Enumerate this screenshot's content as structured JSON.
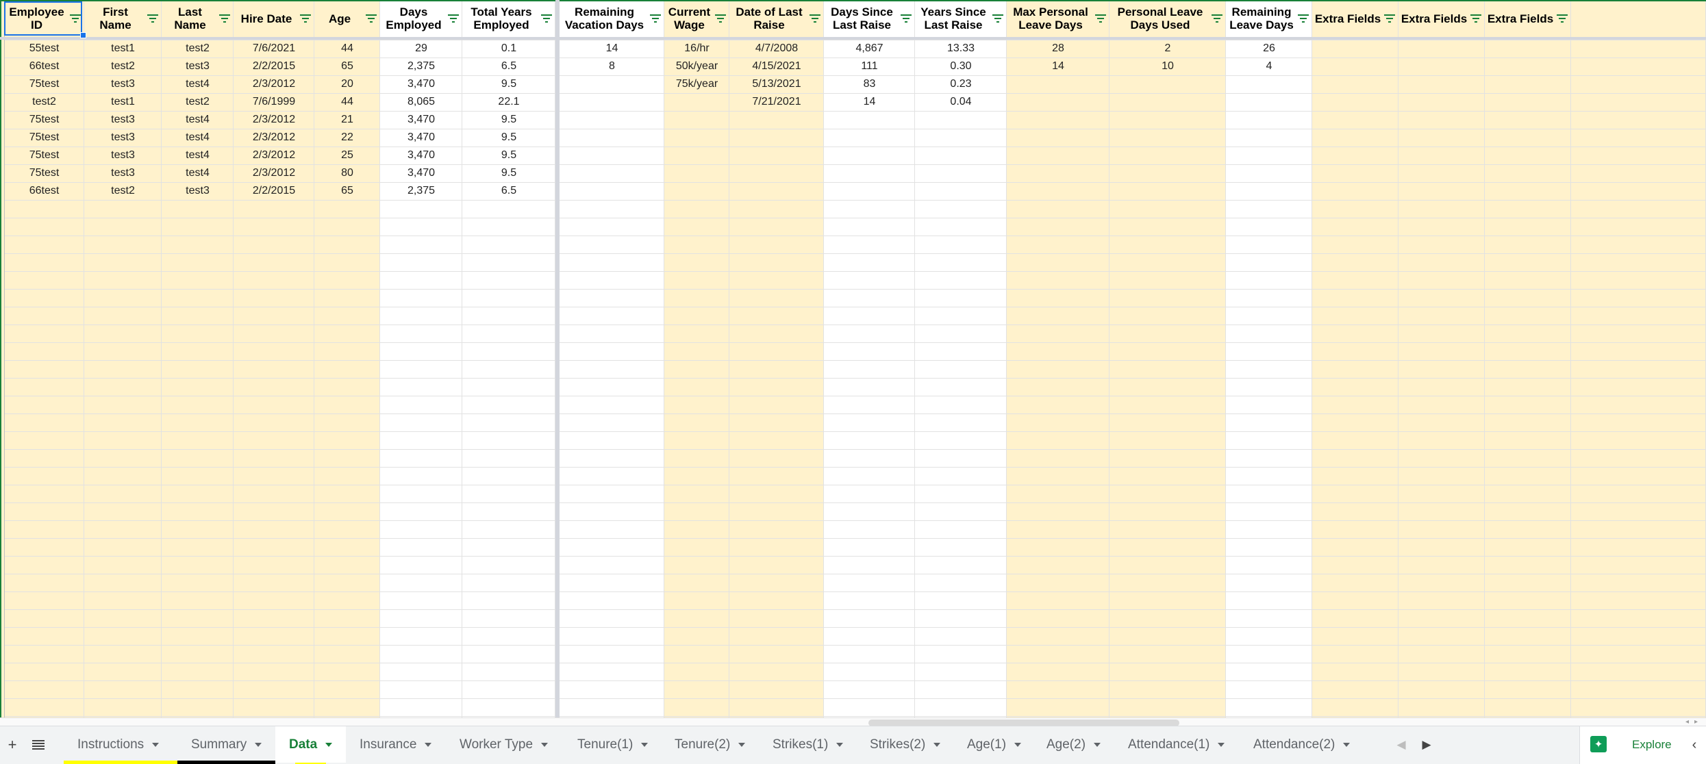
{
  "columns": [
    {
      "label": "Employee ID",
      "lines": [
        "Employee",
        "ID"
      ],
      "shade": "yellow"
    },
    {
      "label": "First Name",
      "lines": [
        "First",
        "Name"
      ],
      "shade": "yellow"
    },
    {
      "label": "Last Name",
      "lines": [
        "Last",
        "Name"
      ],
      "shade": "yellow"
    },
    {
      "label": "Hire Date",
      "lines": [
        "Hire Date"
      ],
      "shade": "yellow"
    },
    {
      "label": "Age",
      "lines": [
        "Age"
      ],
      "shade": "yellow"
    },
    {
      "label": "Days Employed",
      "lines": [
        "Days",
        "Employed"
      ],
      "shade": "white"
    },
    {
      "label": "Total Years Employed",
      "lines": [
        "Total Years",
        "Employed"
      ],
      "shade": "white"
    },
    {
      "label": "Remaining Vacation Days",
      "lines": [
        "Remaining",
        "Vacation Days"
      ],
      "shade": "white"
    },
    {
      "label": "Current Wage",
      "lines": [
        "Current",
        "Wage"
      ],
      "shade": "yellow"
    },
    {
      "label": "Date of Last Raise",
      "lines": [
        "Date of Last",
        "Raise"
      ],
      "shade": "yellow"
    },
    {
      "label": "Days Since Last Raise",
      "lines": [
        "Days Since",
        "Last Raise"
      ],
      "shade": "white"
    },
    {
      "label": "Years Since Last Raise",
      "lines": [
        "Years Since",
        "Last Raise"
      ],
      "shade": "white"
    },
    {
      "label": "Max Personal Leave Days",
      "lines": [
        "Max Personal",
        "Leave Days"
      ],
      "shade": "yellow"
    },
    {
      "label": "Personal Leave Days Used",
      "lines": [
        "Personal Leave",
        "Days Used"
      ],
      "shade": "yellow"
    },
    {
      "label": "Remaining Leave Days",
      "lines": [
        "Remaining",
        "Leave Days"
      ],
      "shade": "white"
    },
    {
      "label": "Extra Fields",
      "lines": [
        "Extra",
        "Fields"
      ],
      "shade": "yellow"
    },
    {
      "label": "Extra Fields",
      "lines": [
        "Extra",
        "Fields"
      ],
      "shade": "yellow"
    },
    {
      "label": "Extra Fields",
      "lines": [
        "Extra",
        "Fields"
      ],
      "shade": "yellow"
    },
    {
      "label": "",
      "lines": [],
      "shade": "yellow"
    }
  ],
  "rows": [
    [
      "55test",
      "test1",
      "test2",
      "7/6/2021",
      "44",
      "29",
      "0.1",
      "14",
      "16/hr",
      "4/7/2008",
      "4,867",
      "13.33",
      "28",
      "2",
      "26",
      "",
      "",
      "",
      ""
    ],
    [
      "66test",
      "test2",
      "test3",
      "2/2/2015",
      "65",
      "2,375",
      "6.5",
      "8",
      "50k/year",
      "4/15/2021",
      "111",
      "0.30",
      "14",
      "10",
      "4",
      "",
      "",
      "",
      ""
    ],
    [
      "75test",
      "test3",
      "test4",
      "2/3/2012",
      "20",
      "3,470",
      "9.5",
      "",
      "75k/year",
      "5/13/2021",
      "83",
      "0.23",
      "",
      "",
      "",
      "",
      "",
      "",
      ""
    ],
    [
      "test2",
      "test1",
      "test2",
      "7/6/1999",
      "44",
      "8,065",
      "22.1",
      "",
      "",
      "7/21/2021",
      "14",
      "0.04",
      "",
      "",
      "",
      "",
      "",
      "",
      ""
    ],
    [
      "75test",
      "test3",
      "test4",
      "2/3/2012",
      "21",
      "3,470",
      "9.5",
      "",
      "",
      "",
      "",
      "",
      "",
      "",
      "",
      "",
      "",
      "",
      ""
    ],
    [
      "75test",
      "test3",
      "test4",
      "2/3/2012",
      "22",
      "3,470",
      "9.5",
      "",
      "",
      "",
      "",
      "",
      "",
      "",
      "",
      "",
      "",
      "",
      ""
    ],
    [
      "75test",
      "test3",
      "test4",
      "2/3/2012",
      "25",
      "3,470",
      "9.5",
      "",
      "",
      "",
      "",
      "",
      "",
      "",
      "",
      "",
      "",
      "",
      ""
    ],
    [
      "75test",
      "test3",
      "test4",
      "2/3/2012",
      "80",
      "3,470",
      "9.5",
      "",
      "",
      "",
      "",
      "",
      "",
      "",
      "",
      "",
      "",
      "",
      ""
    ],
    [
      "66test",
      "test2",
      "test3",
      "2/2/2015",
      "65",
      "2,375",
      "6.5",
      "",
      "",
      "",
      "",
      "",
      "",
      "",
      "",
      "",
      "",
      "",
      ""
    ]
  ],
  "sheet_tabs": [
    {
      "label": "Instructions",
      "active": false,
      "color": "#ffff00"
    },
    {
      "label": "Summary",
      "active": false,
      "color": "#000000"
    },
    {
      "label": "Data",
      "active": true,
      "color": "#ffff00"
    },
    {
      "label": "Insurance",
      "active": false,
      "color": ""
    },
    {
      "label": "Worker Type",
      "active": false,
      "color": ""
    },
    {
      "label": "Tenure(1)",
      "active": false,
      "color": ""
    },
    {
      "label": "Tenure(2)",
      "active": false,
      "color": ""
    },
    {
      "label": "Strikes(1)",
      "active": false,
      "color": ""
    },
    {
      "label": "Strikes(2)",
      "active": false,
      "color": ""
    },
    {
      "label": "Age(1)",
      "active": false,
      "color": ""
    },
    {
      "label": "Age(2)",
      "active": false,
      "color": ""
    },
    {
      "label": "Attendance(1)",
      "active": false,
      "color": ""
    },
    {
      "label": "Attendance(2)",
      "active": false,
      "color": ""
    }
  ],
  "explore": {
    "label": "Explore"
  },
  "colors": {
    "cell_yellow": "#fff2cc",
    "grid_line": "#e2e2e2",
    "active_tab_text": "#188038",
    "filter_icon": "#188038",
    "selection": "#1a73e8",
    "explore_icon": "#0f9d58"
  },
  "icons": {
    "add_sheet": "plus-icon",
    "all_sheets": "list-icon",
    "filter": "filter-icon",
    "scroll_tabs_left": "chevron-left-icon",
    "scroll_tabs_right": "chevron-right-icon",
    "explore": "explore-icon",
    "collapse": "chevron-left-icon"
  }
}
